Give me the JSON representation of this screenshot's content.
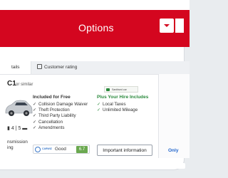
{
  "header": {
    "title": "Options"
  },
  "tabs": [
    {
      "label": "tails"
    },
    {
      "label": "Customer rating"
    }
  ],
  "car": {
    "name": "C1",
    "similar": "or similar",
    "seats": "4",
    "bags": "5",
    "transmission_line1": "nsmission",
    "transmission_line2": "ing"
  },
  "badge": {
    "sanitised": "Sanitised car"
  },
  "included": {
    "heading": "Included for Free",
    "items": [
      "Collision Damage Waiver",
      "Theft Protection",
      "Third Party Liability",
      "Cancellation",
      "Amendments"
    ]
  },
  "plus": {
    "heading": "Plus Your Hire Includes",
    "items": [
      "Local Taxes",
      "Unlimited Mileage"
    ]
  },
  "rating": {
    "brand": "CARWIZ",
    "word": "Good",
    "score": "6.7"
  },
  "buttons": {
    "info": "Important information"
  },
  "right": {
    "text": "Only"
  },
  "colors": {
    "brand_red": "#d4061f",
    "green": "#2a8a3c",
    "blue": "#2266cc",
    "rating_green": "#6aa84f"
  }
}
